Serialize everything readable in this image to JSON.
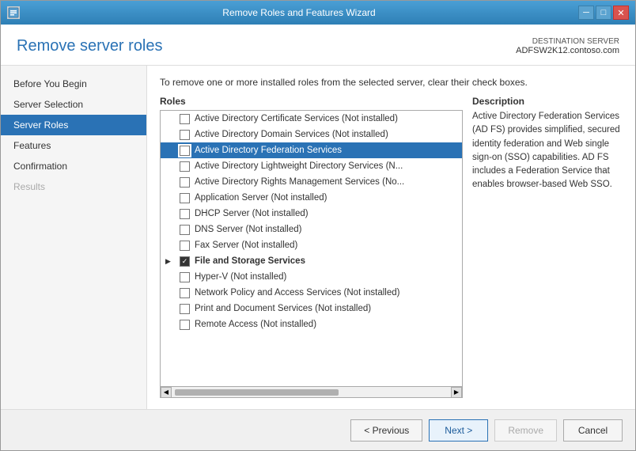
{
  "window": {
    "title": "Remove Roles and Features Wizard",
    "icon": "📋"
  },
  "title_controls": {
    "minimize": "─",
    "restore": "□",
    "close": "✕"
  },
  "header": {
    "title": "Remove server roles",
    "dest_label": "DESTINATION SERVER",
    "dest_server": "ADFSW2K12.contoso.com"
  },
  "instruction": "To remove one or more installed roles from the selected server, clear their check boxes.",
  "sidebar": {
    "items": [
      {
        "id": "before-you-begin",
        "label": "Before You Begin",
        "state": "normal"
      },
      {
        "id": "server-selection",
        "label": "Server Selection",
        "state": "normal"
      },
      {
        "id": "server-roles",
        "label": "Server Roles",
        "state": "active"
      },
      {
        "id": "features",
        "label": "Features",
        "state": "normal"
      },
      {
        "id": "confirmation",
        "label": "Confirmation",
        "state": "normal"
      },
      {
        "id": "results",
        "label": "Results",
        "state": "disabled"
      }
    ]
  },
  "roles_panel": {
    "header": "Roles",
    "items": [
      {
        "id": "adcs",
        "label": "Active Directory Certificate Services (Not installed)",
        "checked": false,
        "selected": false,
        "expanded": false,
        "indent": 0
      },
      {
        "id": "adds",
        "label": "Active Directory Domain Services (Not installed)",
        "checked": false,
        "selected": false,
        "expanded": false,
        "indent": 0
      },
      {
        "id": "adfs",
        "label": "Active Directory Federation Services",
        "checked": false,
        "selected": true,
        "expanded": false,
        "indent": 0
      },
      {
        "id": "adlds",
        "label": "Active Directory Lightweight Directory Services (N...",
        "checked": false,
        "selected": false,
        "expanded": false,
        "indent": 0
      },
      {
        "id": "adrms",
        "label": "Active Directory Rights Management Services (No...",
        "checked": false,
        "selected": false,
        "expanded": false,
        "indent": 0
      },
      {
        "id": "appserver",
        "label": "Application Server (Not installed)",
        "checked": false,
        "selected": false,
        "expanded": false,
        "indent": 0
      },
      {
        "id": "dhcp",
        "label": "DHCP Server (Not installed)",
        "checked": false,
        "selected": false,
        "expanded": false,
        "indent": 0
      },
      {
        "id": "dns",
        "label": "DNS Server (Not installed)",
        "checked": false,
        "selected": false,
        "expanded": false,
        "indent": 0
      },
      {
        "id": "fax",
        "label": "Fax Server (Not installed)",
        "checked": false,
        "selected": false,
        "expanded": false,
        "indent": 0
      },
      {
        "id": "fileandstorage",
        "label": "File and Storage Services",
        "checked": true,
        "selected": false,
        "expanded": true,
        "indent": 0,
        "bold": true
      },
      {
        "id": "hyperv",
        "label": "Hyper-V (Not installed)",
        "checked": false,
        "selected": false,
        "expanded": false,
        "indent": 0
      },
      {
        "id": "npas",
        "label": "Network Policy and Access Services (Not installed)",
        "checked": false,
        "selected": false,
        "expanded": false,
        "indent": 0
      },
      {
        "id": "pds",
        "label": "Print and Document Services (Not installed)",
        "checked": false,
        "selected": false,
        "expanded": false,
        "indent": 0
      },
      {
        "id": "remoteaccess",
        "label": "Remote Access (Not installed)",
        "checked": false,
        "selected": false,
        "expanded": false,
        "indent": 0
      }
    ]
  },
  "description_panel": {
    "header": "Description",
    "text": "Active Directory Federation Services (AD FS) provides simplified, secured identity federation and Web single sign-on (SSO) capabilities. AD FS includes a Federation Service that enables browser-based Web SSO."
  },
  "footer": {
    "previous_label": "< Previous",
    "next_label": "Next >",
    "remove_label": "Remove",
    "cancel_label": "Cancel"
  }
}
